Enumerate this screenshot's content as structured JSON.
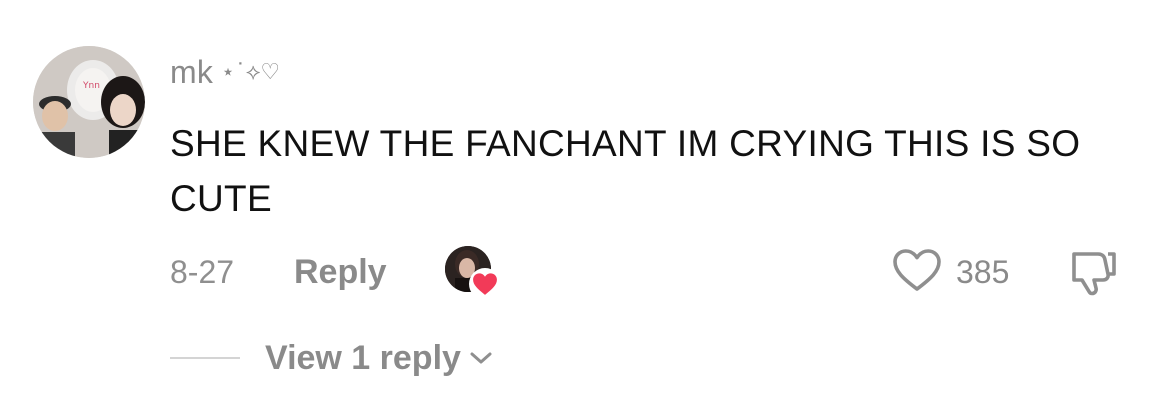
{
  "comment": {
    "username": "mk",
    "username_decoration": "⋆˙⟡♡",
    "text": "SHE KNEW THE FANCHANT IM CRYING THIS IS SO CUTE",
    "date": "8-27",
    "reply_label": "Reply",
    "like_count": "385",
    "view_replies_label": "View 1 reply"
  },
  "icons": {
    "avatar": "user-avatar-photo",
    "creator_like": "creator-liked-avatar",
    "creator_heart": "red-heart-icon",
    "like": "heart-outline-icon",
    "dislike": "thumbs-down-icon",
    "chevron": "chevron-down-icon"
  },
  "colors": {
    "text_primary": "#111111",
    "text_secondary": "#8a8a8a",
    "heart_red": "#f23a58",
    "divider": "#d4d4d4"
  }
}
